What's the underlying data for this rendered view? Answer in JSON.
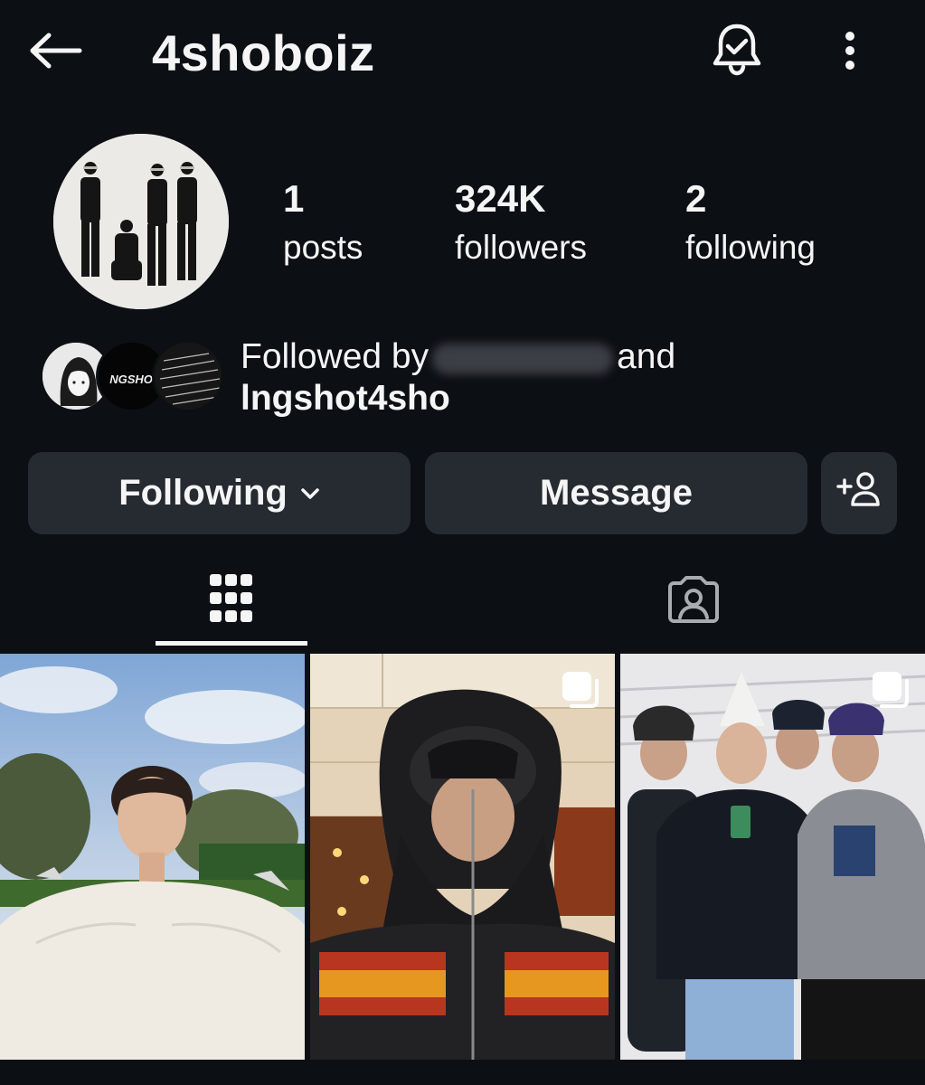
{
  "header": {
    "back_icon": "arrow-left-icon",
    "username": "4shoboiz",
    "notifications_icon": "bell-check-icon",
    "more_icon": "more-vertical-icon"
  },
  "profile": {
    "avatar_icon": "profile-photo",
    "stats": [
      {
        "value": "1",
        "label": "posts"
      },
      {
        "value": "324K",
        "label": "followers"
      },
      {
        "value": "2",
        "label": "following"
      }
    ]
  },
  "mutuals": {
    "prefix": "Followed by",
    "suffix": "and",
    "second_user": "lngshot4sho",
    "avatar_badge_text": "NGSHOT"
  },
  "actions": {
    "following_label": "Following",
    "message_label": "Message",
    "add_user_icon": "add-person-icon"
  },
  "tabs": [
    {
      "name": "posts-grid",
      "icon": "grid-icon",
      "active": true
    },
    {
      "name": "tagged",
      "icon": "tagged-portrait-icon",
      "active": false
    }
  ],
  "colors": {
    "background": "#0c0f14",
    "button_bg": "#262a31",
    "text": "#f5f5f5"
  }
}
